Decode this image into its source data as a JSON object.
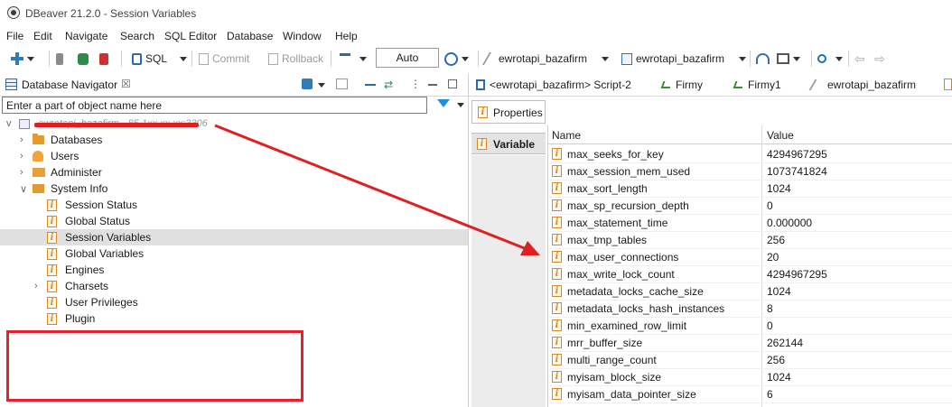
{
  "window": {
    "title": "DBeaver 21.2.0 - Session Variables"
  },
  "menu": [
    "File",
    "Edit",
    "Navigate",
    "Search",
    "SQL Editor",
    "Database",
    "Window",
    "Help"
  ],
  "toolbar": {
    "sql_label": "SQL",
    "commit_label": "Commit",
    "rollback_label": "Rollback",
    "mode_value": "Auto",
    "datasource_label": "ewrotapi_bazafirm",
    "schema_label": "ewrotapi_bazafirm"
  },
  "navigator": {
    "title": "Database Navigator",
    "close_glyph": "☒",
    "filter_placeholder": "Enter a part of object name here",
    "connection_label": "ewrotapi_bazafirm - 85.1xx.xx.xx:3306",
    "items": [
      {
        "label": "Databases",
        "kind": "folder",
        "twisty": ">"
      },
      {
        "label": "Users",
        "kind": "users",
        "twisty": ">"
      },
      {
        "label": "Administer",
        "kind": "admin",
        "twisty": ">"
      },
      {
        "label": "System Info",
        "kind": "sysinfo",
        "twisty": "v"
      },
      {
        "label": "Session Status",
        "kind": "info"
      },
      {
        "label": "Global Status",
        "kind": "info"
      },
      {
        "label": "Session Variables",
        "kind": "info",
        "selected": true
      },
      {
        "label": "Global Variables",
        "kind": "info"
      },
      {
        "label": "Engines",
        "kind": "info"
      },
      {
        "label": "Charsets",
        "kind": "info",
        "twisty": ">"
      },
      {
        "label": "User Privileges",
        "kind": "info"
      },
      {
        "label": "Plugin",
        "kind": "info"
      }
    ]
  },
  "editor_tabs": [
    {
      "label": "<ewrotapi_bazafirm> Script-2"
    },
    {
      "label": "Firmy"
    },
    {
      "label": "Firmy1"
    },
    {
      "label": "ewrotapi_bazafirm"
    }
  ],
  "side_tabs": {
    "properties": "Properties",
    "variable": "Variable"
  },
  "grid": {
    "columns": [
      "Name",
      "Value"
    ],
    "rows": [
      {
        "name": "max_seeks_for_key",
        "value": "4294967295"
      },
      {
        "name": "max_session_mem_used",
        "value": "1073741824"
      },
      {
        "name": "max_sort_length",
        "value": "1024"
      },
      {
        "name": "max_sp_recursion_depth",
        "value": "0"
      },
      {
        "name": "max_statement_time",
        "value": "0.000000"
      },
      {
        "name": "max_tmp_tables",
        "value": "256"
      },
      {
        "name": "max_user_connections",
        "value": "20"
      },
      {
        "name": "max_write_lock_count",
        "value": "4294967295"
      },
      {
        "name": "metadata_locks_cache_size",
        "value": "1024"
      },
      {
        "name": "metadata_locks_hash_instances",
        "value": "8"
      },
      {
        "name": "min_examined_row_limit",
        "value": "0"
      },
      {
        "name": "mrr_buffer_size",
        "value": "262144"
      },
      {
        "name": "multi_range_count",
        "value": "256"
      },
      {
        "name": "myisam_block_size",
        "value": "1024"
      },
      {
        "name": "myisam_data_pointer_size",
        "value": "6"
      }
    ]
  },
  "colors": {
    "annotation_red": "#e02020",
    "selection": "#e0e0e0",
    "info_icon": "#d98a1f"
  }
}
